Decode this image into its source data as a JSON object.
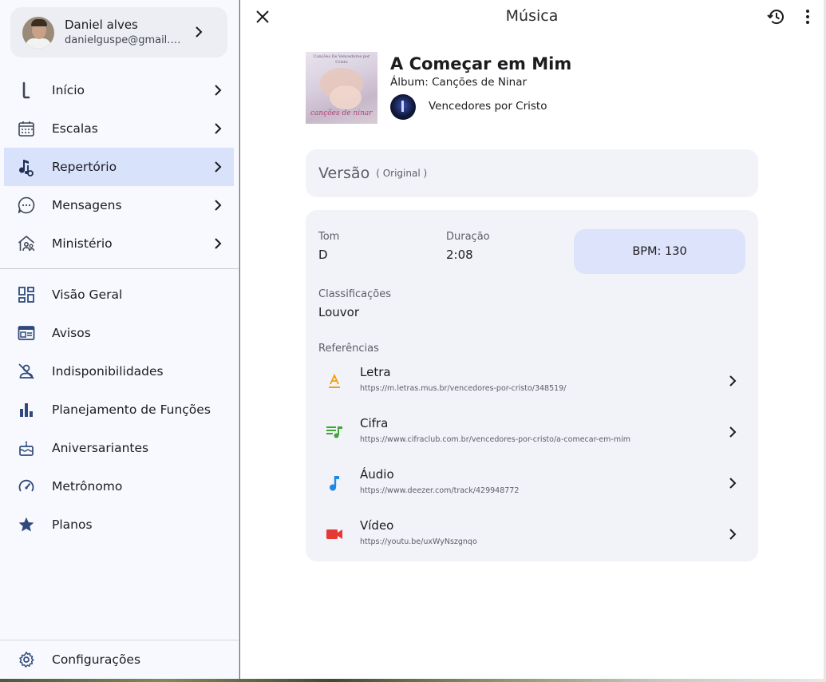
{
  "profile": {
    "name": "Daniel alves",
    "email": "danielguspe@gmail.c..."
  },
  "nav_primary": [
    {
      "label": "Início",
      "icon": "home-icon"
    },
    {
      "label": "Escalas",
      "icon": "calendar-grid-icon"
    },
    {
      "label": "Repertório",
      "icon": "music-library-icon",
      "active": true
    },
    {
      "label": "Mensagens",
      "icon": "chat-bubble-icon"
    },
    {
      "label": "Ministério",
      "icon": "group-home-icon"
    }
  ],
  "nav_secondary": [
    {
      "label": "Visão Geral",
      "icon": "dashboard-icon"
    },
    {
      "label": "Avisos",
      "icon": "notice-board-icon"
    },
    {
      "label": "Indisponibilidades",
      "icon": "person-off-icon"
    },
    {
      "label": "Planejamento de Funções",
      "icon": "bar-chart-icon"
    },
    {
      "label": "Aniversariantes",
      "icon": "cake-icon"
    },
    {
      "label": "Metrônomo",
      "icon": "speed-gauge-icon"
    },
    {
      "label": "Planos",
      "icon": "star-icon"
    }
  ],
  "settings_label": "Configurações",
  "header": {
    "title": "Música"
  },
  "song": {
    "title": "A Começar em Mim",
    "album": "Álbum: Canções de Ninar",
    "artist": "Vencedores por Cristo",
    "cover_top_text": "Canções De Vencedores por Cristo",
    "cover_sub_text": "canções de ninar"
  },
  "version": {
    "label": "Versão",
    "tag": "( Original )"
  },
  "details": {
    "tom_label": "Tom",
    "tom_value": "D",
    "duracao_label": "Duração",
    "duracao_value": "2:08",
    "bpm_text": "BPM: 130",
    "classificacoes_label": "Classificações",
    "classificacoes_value": "Louvor",
    "referencias_label": "Referências"
  },
  "references": [
    {
      "title": "Letra",
      "url": "https://m.letras.mus.br/vencedores-por-cristo/348519/",
      "icon": "lyrics-icon",
      "color": "#f59f00"
    },
    {
      "title": "Cifra",
      "url": "https://www.cifraclub.com.br/vencedores-por-cristo/a-comecar-em-mim",
      "icon": "queue-music-icon",
      "color": "#3fa535"
    },
    {
      "title": "Áudio",
      "url": "https://www.deezer.com/track/429948772",
      "icon": "music-note-icon",
      "color": "#1e88e5"
    },
    {
      "title": "Vídeo",
      "url": "https://youtu.be/uxWyNszgnqo",
      "icon": "videocam-icon",
      "color": "#e53935"
    }
  ]
}
